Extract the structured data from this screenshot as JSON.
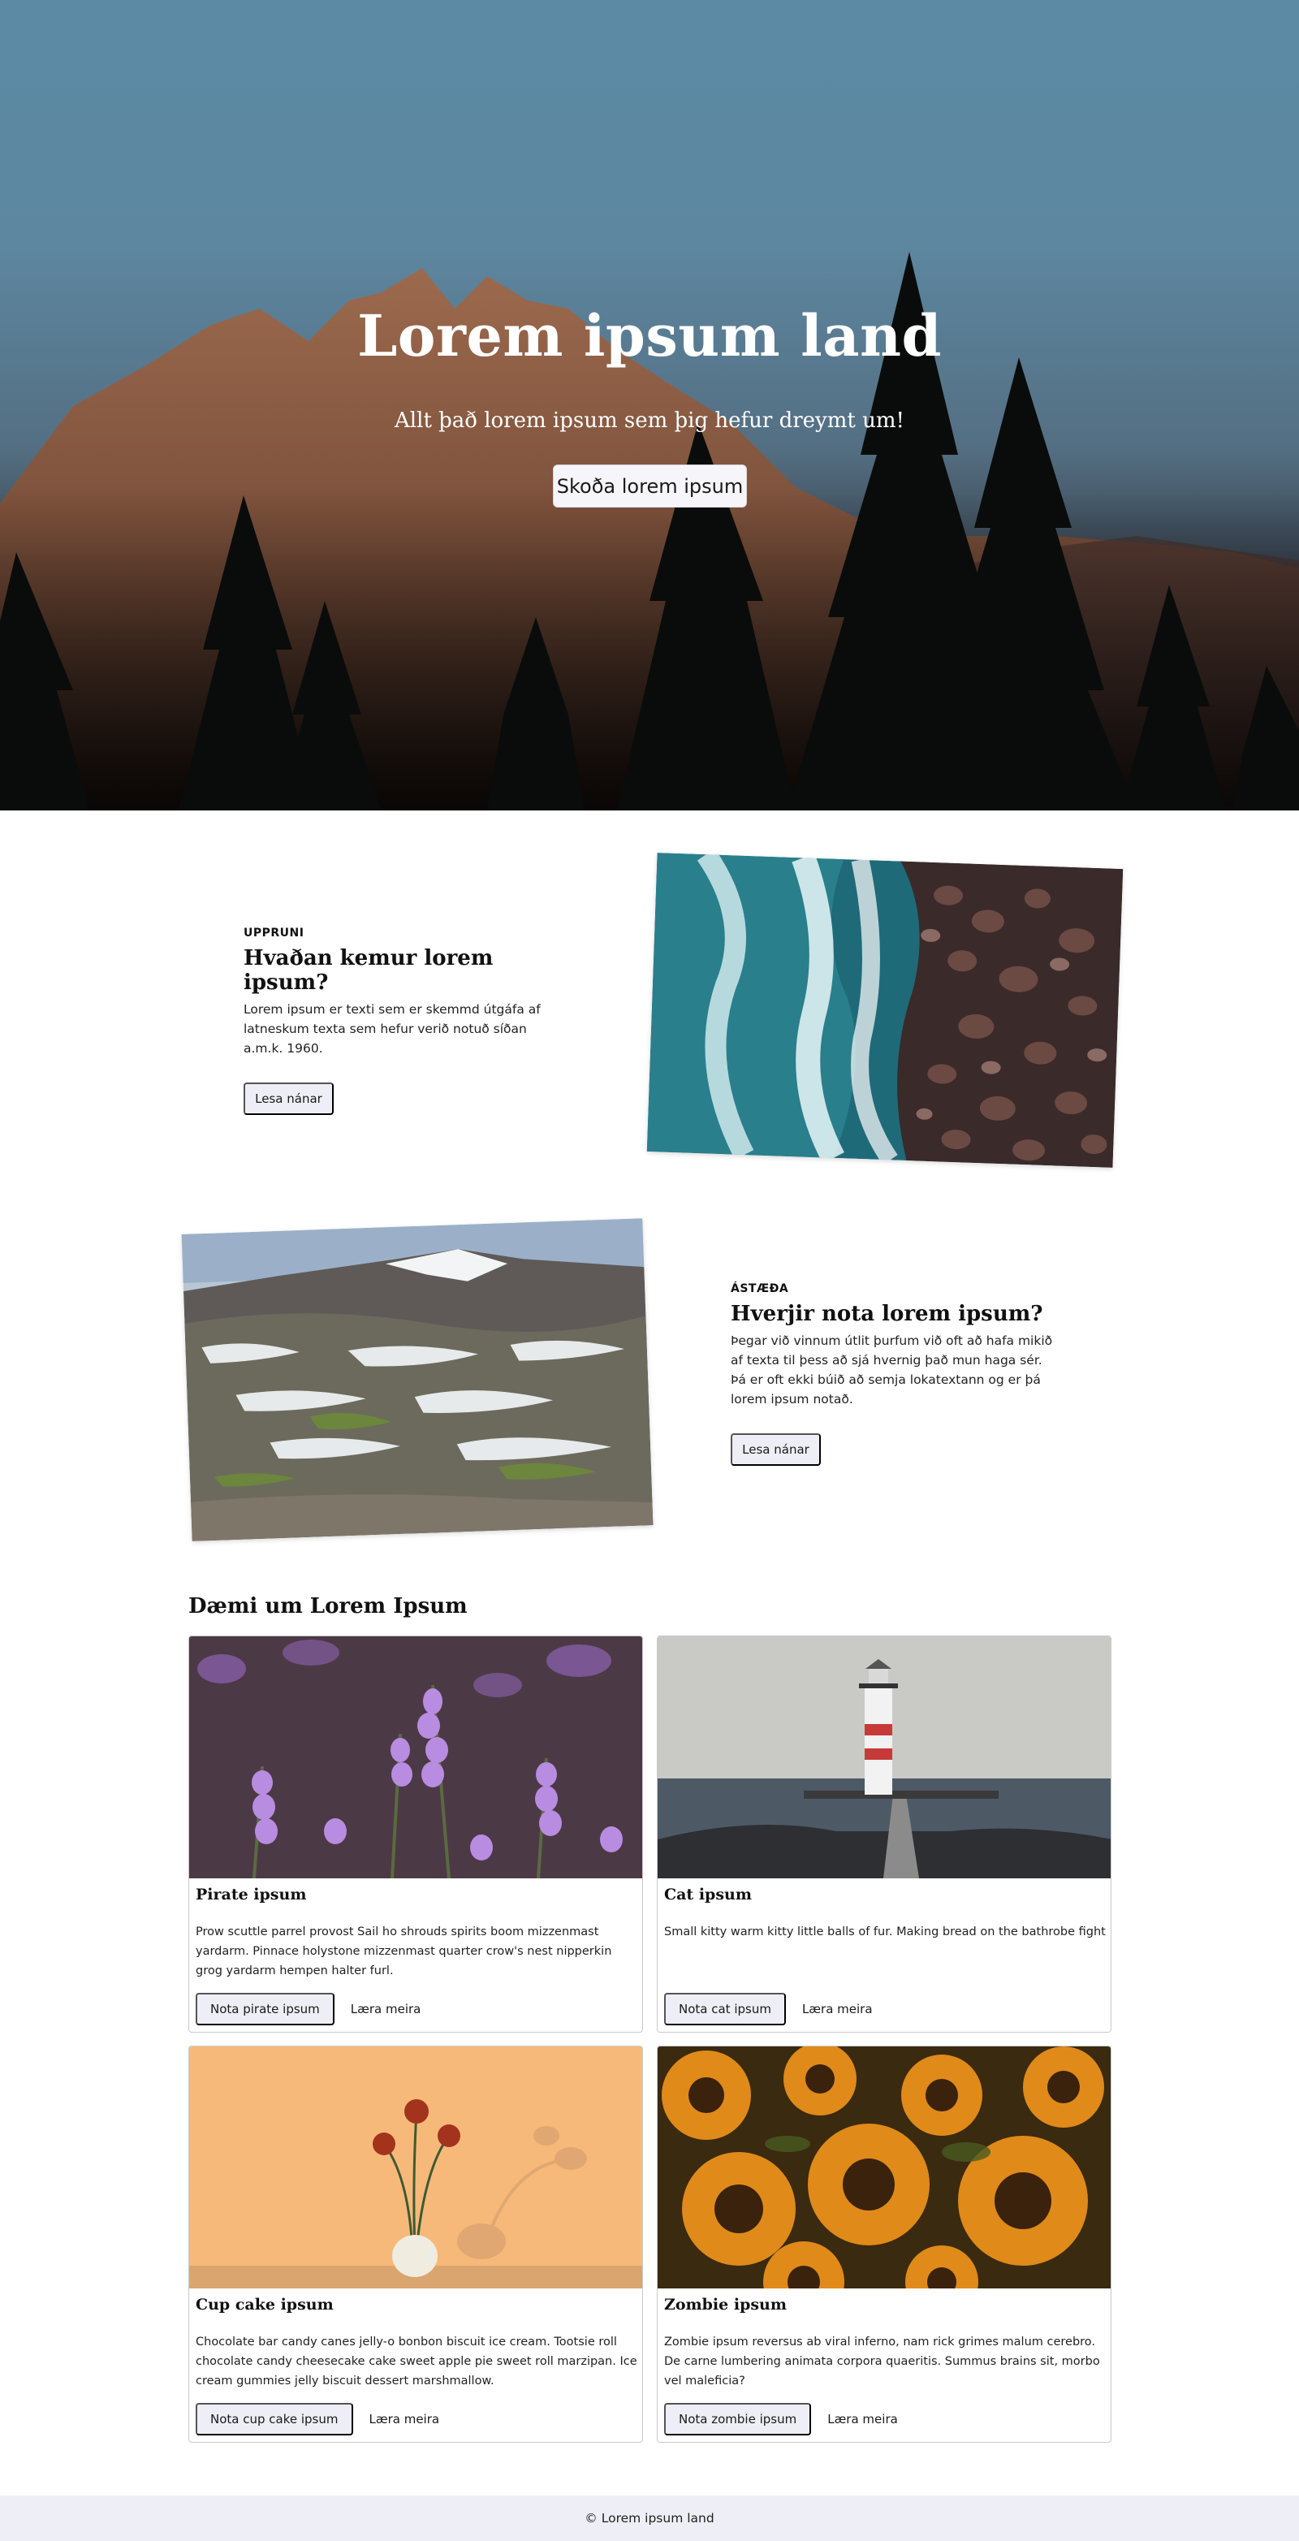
{
  "hero": {
    "title": "Lorem ipsum land",
    "subtitle": "Allt það lorem ipsum sem þig hefur dreymt um!",
    "button_label": "Skoða lorem ipsum"
  },
  "features": [
    {
      "eyebrow": "UPPRUNI",
      "title": "Hvaðan kemur lorem ipsum?",
      "body": "Lorem ipsum er texti sem er skemmd útgáfa af latneskum texta sem hefur verið notuð síðan a.m.k. 1960.",
      "button_label": "Lesa nánar",
      "image": "ocean-waves-rocky-shore-aerial-photo"
    },
    {
      "eyebrow": "ÁSTÆÐA",
      "title": "Hverjir nota lorem ipsum?",
      "body": "Þegar við vinnum útlit þurfum við oft að hafa mikið af texta til þess að sjá hvernig það mun haga sér. Þá er oft ekki búið að semja lokatextann og er þá lorem ipsum notað.",
      "button_label": "Lesa nánar",
      "image": "snowy-mountain-landscape-photo"
    }
  ],
  "examples": {
    "title": "Dæmi um Lorem Ipsum",
    "cards": [
      {
        "title": "Pirate ipsum",
        "body": "Prow scuttle parrel provost Sail ho shrouds spirits boom mizzenmast yardarm. Pinnace holystone mizzenmast quarter crow's nest nipperkin grog yardarm hempen halter furl.",
        "primary_label": "Nota pirate ipsum",
        "link_label": "Læra meira",
        "image": "purple-lavender-flowers-photo"
      },
      {
        "title": "Cat ipsum",
        "body": "Small kitty warm kitty little balls of fur. Making bread on the bathrobe fight",
        "primary_label": "Nota cat ipsum",
        "link_label": "Læra meira",
        "image": "lighthouse-pier-photo"
      },
      {
        "title": "Cup cake ipsum",
        "body": "Chocolate bar candy canes jelly-o bonbon biscuit ice cream. Tootsie roll chocolate candy cheesecake cake sweet apple pie sweet roll marzipan. Ice cream gummies jelly biscuit dessert marshmallow.",
        "primary_label": "Nota cup cake ipsum",
        "link_label": "Læra meira",
        "image": "flower-vase-orange-wall-photo"
      },
      {
        "title": "Zombie ipsum",
        "body": "Zombie ipsum reversus ab viral inferno, nam rick grimes malum cerebro. De carne lumbering animata corpora quaeritis. Summus brains sit, morbo vel maleficia?",
        "primary_label": "Nota zombie ipsum",
        "link_label": "Læra meira",
        "image": "sunflower-field-photo"
      }
    ]
  },
  "footer": {
    "text": "© Lorem ipsum land"
  },
  "colors": {
    "hero_sky": "#5c8aa4",
    "button_soft_bg": "#eeeef6",
    "footer_bg": "#eeeef6"
  }
}
